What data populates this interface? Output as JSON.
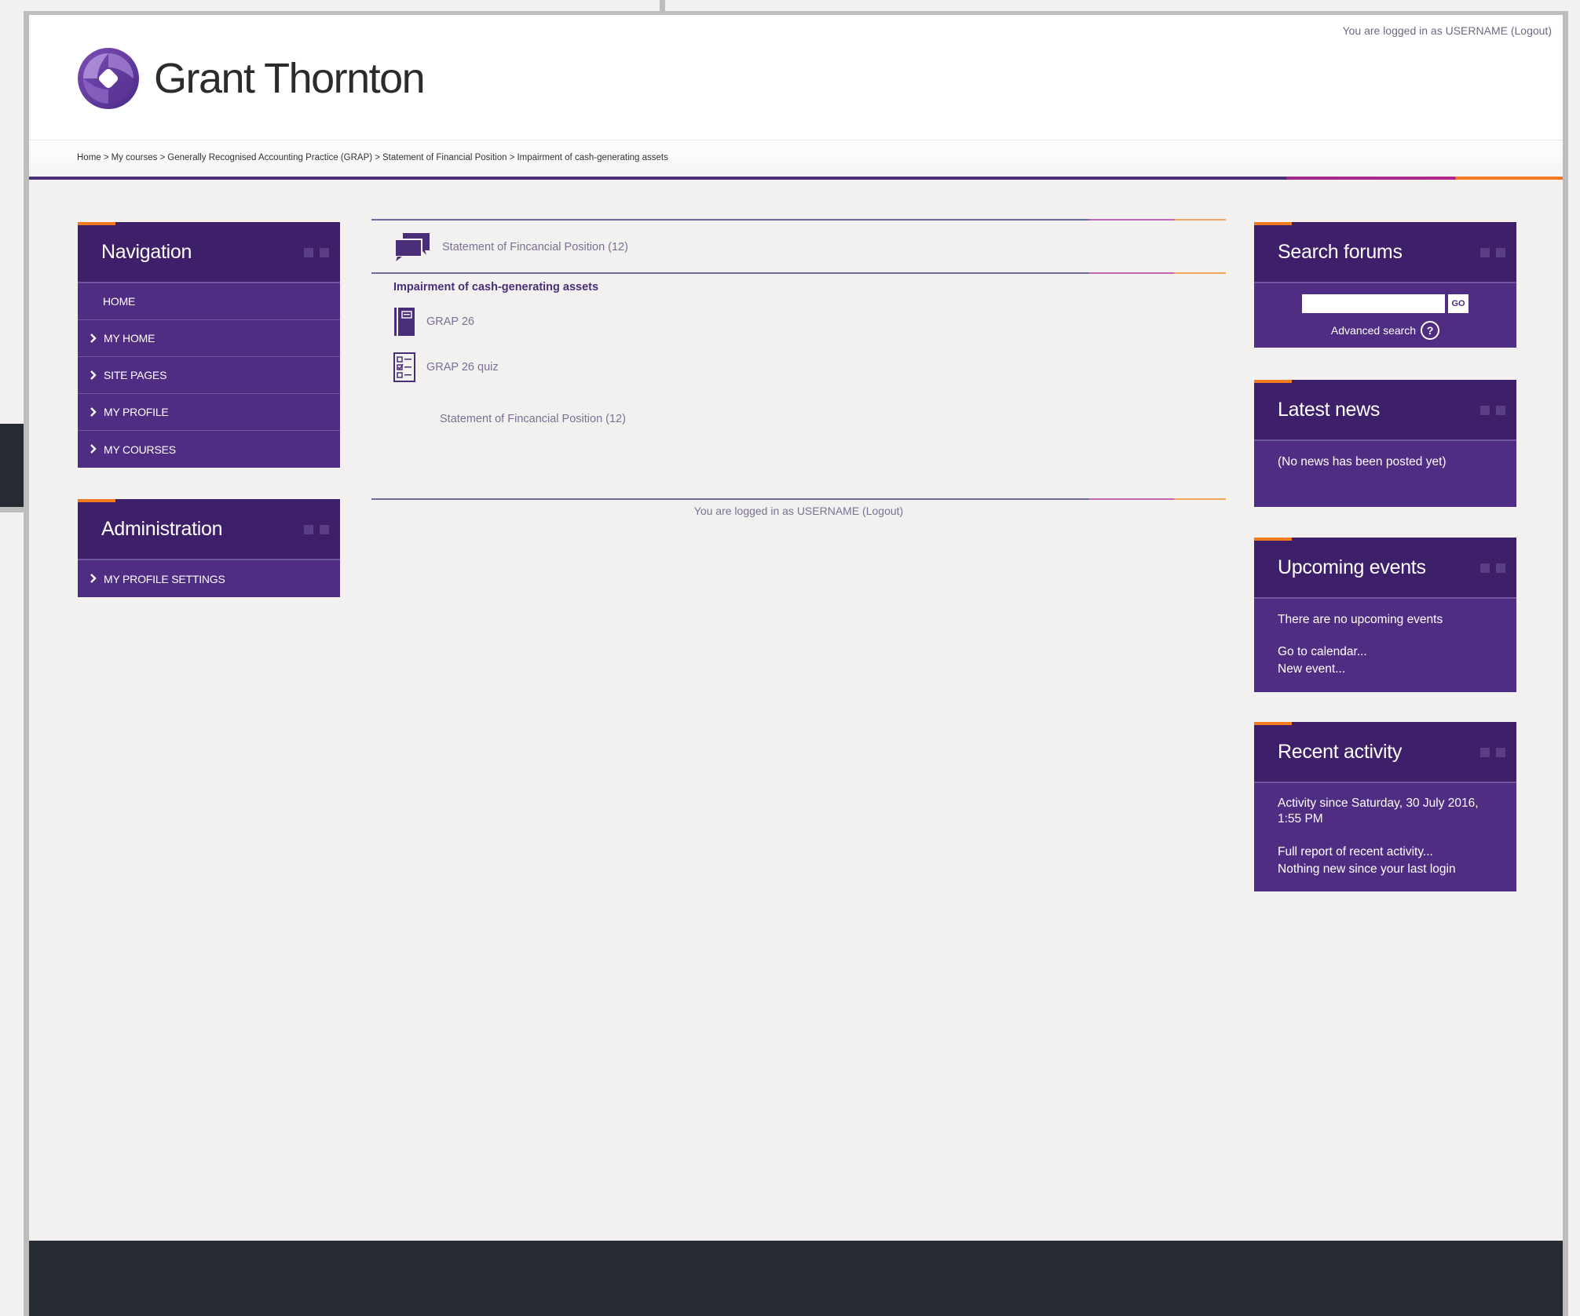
{
  "header": {
    "brand": "Grant Thornton",
    "login_text": "You are logged in as USERNAME",
    "logout_text": "(Logout)"
  },
  "breadcrumb": [
    "Home >",
    "My courses >",
    "Generally Recognised Accounting Practice (GRAP) >",
    "Statement of Financial Position >",
    "Impairment of cash-generating assets"
  ],
  "navigation": {
    "title": "Navigation",
    "items": [
      "HOME",
      "MY HOME",
      "SITE PAGES",
      "MY PROFILE",
      "MY COURSES"
    ]
  },
  "administration": {
    "title": "Administration",
    "items": [
      "MY PROFILE SETTINGS"
    ]
  },
  "main": {
    "forum_link": "Statement of Fincancial Position (12)",
    "section_title": "Impairment of cash-generating assets",
    "activities": [
      {
        "label": "GRAP 26",
        "icon": "book-icon"
      },
      {
        "label": "GRAP 26 quiz",
        "icon": "quiz-icon"
      }
    ],
    "sub_link": "Statement of Fincancial Position (12)",
    "login_text": "You are logged in as USERNAME (Logout)"
  },
  "search_forums": {
    "title": "Search forums",
    "go_label": "GO",
    "advanced": "Advanced search",
    "help": "?"
  },
  "latest_news": {
    "title": "Latest news",
    "body": "(No news has been posted yet)"
  },
  "upcoming_events": {
    "title": "Upcoming events",
    "body": "There are no upcoming events",
    "link1": "Go to calendar...",
    "link2": "New event..."
  },
  "recent_activity": {
    "title": "Recent activity",
    "body": "Activity since Saturday, 30 July 2016, 1:55 PM",
    "link1": "Full report of recent activity...",
    "body2": "Nothing new since your last login"
  },
  "colors": {
    "brand_purple": "#4f2d83",
    "header_purple": "#3e1f6a",
    "accent_orange": "#f47a20",
    "footer_dark": "#262a33"
  }
}
